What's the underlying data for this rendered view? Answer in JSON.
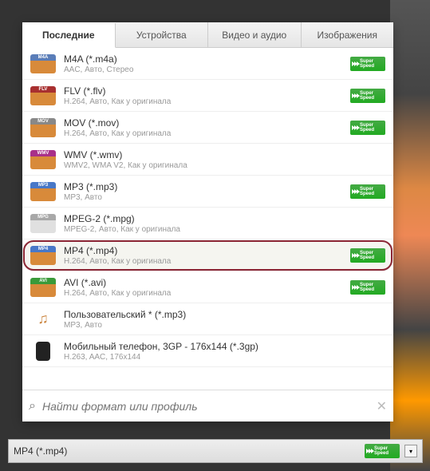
{
  "tabs": [
    "Последние",
    "Устройства",
    "Видео и аудио",
    "Изображения"
  ],
  "active_tab": 0,
  "formats": [
    {
      "tag": "M4A",
      "title": "M4A (*.m4a)",
      "sub": "AAC, Авто, Стерео",
      "super": true,
      "tcol": "#5a7db8",
      "bcol": "#d88a3a"
    },
    {
      "tag": "FLV",
      "title": "FLV (*.flv)",
      "sub": "H.264, Авто, Как у оригинала",
      "super": true,
      "tcol": "#a83030",
      "bcol": "#d88a3a"
    },
    {
      "tag": "MOV",
      "title": "MOV (*.mov)",
      "sub": "H.264, Авто, Как у оригинала",
      "super": true,
      "tcol": "#888",
      "bcol": "#d88a3a"
    },
    {
      "tag": "WMV",
      "title": "WMV (*.wmv)",
      "sub": "WMV2, WMA V2, Как у оригинала",
      "super": false,
      "tcol": "#a8308a",
      "bcol": "#d88a3a"
    },
    {
      "tag": "MP3",
      "title": "MP3 (*.mp3)",
      "sub": "MP3, Авто",
      "super": true,
      "tcol": "#4878c8",
      "bcol": "#d88a3a"
    },
    {
      "tag": "MPG",
      "title": "MPEG-2 (*.mpg)",
      "sub": "MPEG-2, Авто, Как у оригинала",
      "super": false,
      "tcol": "#a8a8a8",
      "bcol": "#e0e0e0"
    },
    {
      "tag": "MP4",
      "title": "MP4 (*.mp4)",
      "sub": "H.264, Авто, Как у оригинала",
      "super": true,
      "tcol": "#4878c8",
      "bcol": "#d88a3a",
      "selected": true
    },
    {
      "tag": "AVI",
      "title": "AVI (*.avi)",
      "sub": "H.264, Авто, Как у оригинала",
      "super": true,
      "tcol": "#3a9a3a",
      "bcol": "#d88a3a"
    },
    {
      "tag": "♫",
      "title": "Пользовательский * (*.mp3)",
      "sub": "MP3, Авто",
      "super": false,
      "tcol": "#fff",
      "bcol": "#fff",
      "note": true
    },
    {
      "tag": "📱",
      "title": "Мобильный телефон, 3GP - 176x144 (*.3gp)",
      "sub": "H.263, AAC, 176x144",
      "super": false,
      "tcol": "#333",
      "bcol": "#333",
      "phone": true
    }
  ],
  "search": {
    "placeholder": "Найти формат или профиль"
  },
  "bottom": {
    "label": "MP4 (*.mp4)"
  },
  "super_badge": "Super Speed"
}
